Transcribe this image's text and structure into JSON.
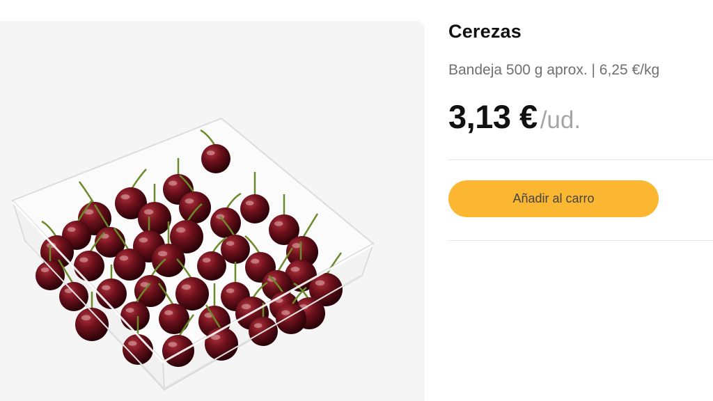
{
  "product": {
    "name": "Cerezas",
    "packaging": "Bandeja 500 g aprox. | 6,25 €/kg",
    "price": "3,13 €",
    "price_unit": "/ud.",
    "image_alt": "",
    "image_icon": "cherries-in-plastic-tray-photo"
  },
  "actions": {
    "add_to_cart_label": "Añadir al carro"
  },
  "colors": {
    "accent": "#fbb731",
    "image_background": "#f5f5f5",
    "cherry": "#6a0f1a"
  }
}
